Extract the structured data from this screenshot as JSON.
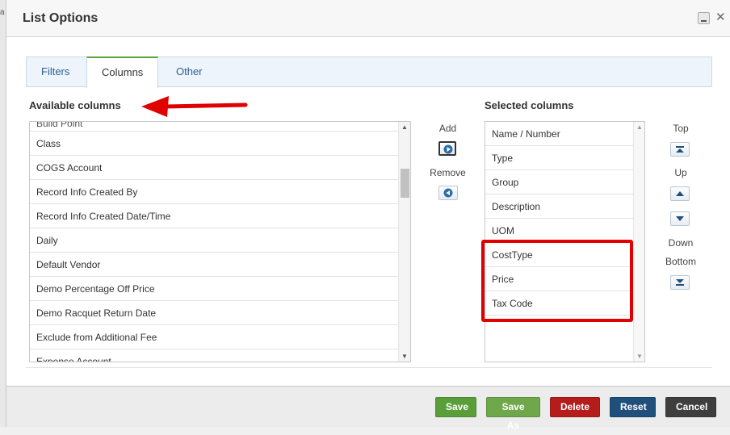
{
  "dialog": {
    "title": "List Options"
  },
  "tabs": [
    {
      "label": "Filters",
      "active": false
    },
    {
      "label": "Columns",
      "active": true
    },
    {
      "label": "Other",
      "active": false
    }
  ],
  "available": {
    "label": "Available columns",
    "items": [
      "Build Point",
      "Class",
      "COGS Account",
      "Record Info Created By",
      "Record Info Created Date/Time",
      "Daily",
      "Default Vendor",
      "Demo Percentage Off Price",
      "Demo Racquet Return Date",
      "Exclude from Additional Fee",
      "Expense Account"
    ]
  },
  "transfer": {
    "add_label": "Add",
    "remove_label": "Remove"
  },
  "selected": {
    "label": "Selected columns",
    "items": [
      "Name / Number",
      "Type",
      "Group",
      "Description",
      "UOM",
      "CostType",
      "Price",
      "Tax Code"
    ]
  },
  "order": {
    "top_label": "Top",
    "up_label": "Up",
    "down_label": "Down",
    "bottom_label": "Bottom"
  },
  "footer": {
    "save": "Save",
    "save_as": "Save As",
    "delete": "Delete",
    "reset": "Reset",
    "cancel": "Cancel"
  },
  "colors": {
    "save": "#5a9e3a",
    "save_as": "#6fa84a",
    "delete": "#b51c1c",
    "reset": "#1f4f7a",
    "cancel": "#3e3e3e",
    "highlight": "#e00000"
  }
}
